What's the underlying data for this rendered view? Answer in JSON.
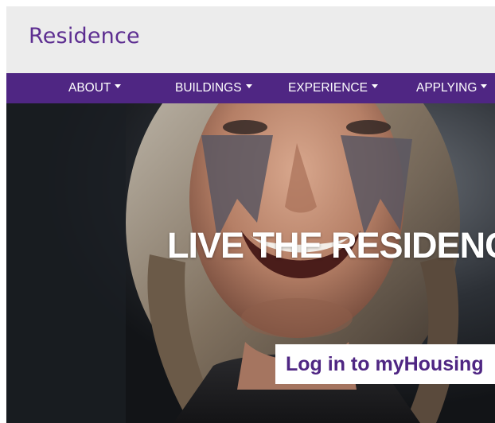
{
  "header": {
    "brand": "Residence"
  },
  "nav": {
    "items": [
      {
        "label": "ABOUT"
      },
      {
        "label": "BUILDINGS"
      },
      {
        "label": "EXPERIENCE"
      },
      {
        "label": "APPLYING"
      }
    ]
  },
  "hero": {
    "headline": "LIVE THE RESIDENCE",
    "login_label": "Log in to myHousing"
  },
  "colors": {
    "brand_purple": "#4f2683",
    "brand_text": "#5d2e91",
    "header_bg": "#ececec",
    "button_bg": "#ffffff"
  },
  "icons": {
    "nav_dropdown": "caret-down-icon"
  }
}
